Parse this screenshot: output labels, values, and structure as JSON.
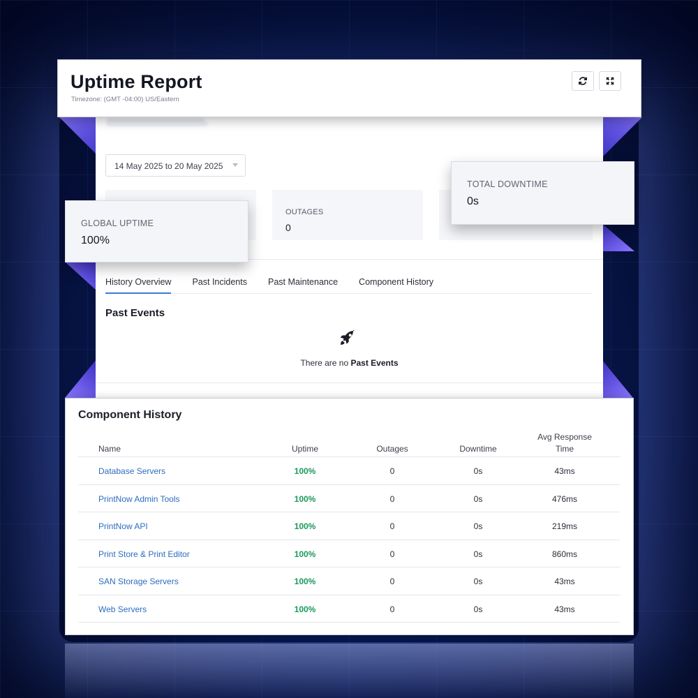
{
  "header": {
    "title": "Uptime Report",
    "timezone": "Timezone: (GMT -04:00) US/Eastern"
  },
  "filters": {
    "date_range": "14 May 2025 to 20 May 2025"
  },
  "stats": {
    "global_uptime_label": "GLOBAL UPTIME",
    "global_uptime_value": "100%",
    "outages_label": "OUTAGES",
    "outages_value": "0",
    "total_downtime_label": "TOTAL DOWNTIME",
    "total_downtime_value": "0s"
  },
  "tabs": [
    {
      "label": "History Overview",
      "active": true
    },
    {
      "label": "Past Incidents",
      "active": false
    },
    {
      "label": "Past Maintenance",
      "active": false
    },
    {
      "label": "Component History",
      "active": false
    }
  ],
  "past_events": {
    "title": "Past Events",
    "empty_prefix": "There are no",
    "empty_bold": "Past Events"
  },
  "component_history": {
    "title": "Component History",
    "columns": {
      "name": "Name",
      "uptime": "Uptime",
      "outages": "Outages",
      "downtime": "Downtime",
      "avg_response_line1": "Avg Response",
      "avg_response_line2": "Time"
    },
    "rows": [
      {
        "name": "Database Servers",
        "uptime": "100%",
        "outages": "0",
        "downtime": "0s",
        "avg_response": "43ms"
      },
      {
        "name": "PrintNow Admin Tools",
        "uptime": "100%",
        "outages": "0",
        "downtime": "0s",
        "avg_response": "476ms"
      },
      {
        "name": "PrintNow API",
        "uptime": "100%",
        "outages": "0",
        "downtime": "0s",
        "avg_response": "219ms"
      },
      {
        "name": "Print Store & Print Editor",
        "uptime": "100%",
        "outages": "0",
        "downtime": "0s",
        "avg_response": "860ms"
      },
      {
        "name": "SAN Storage Servers",
        "uptime": "100%",
        "outages": "0",
        "downtime": "0s",
        "avg_response": "43ms"
      },
      {
        "name": "Web Servers",
        "uptime": "100%",
        "outages": "0",
        "downtime": "0s",
        "avg_response": "43ms"
      }
    ]
  },
  "icons": {
    "refresh": "refresh-icon",
    "expand": "expand-icon",
    "rocket": "rocket-icon"
  },
  "colors": {
    "link": "#2d6cc0",
    "uptime_green": "#1a9a5c",
    "active_tab": "#3a7bd5",
    "background": "#081a55"
  }
}
